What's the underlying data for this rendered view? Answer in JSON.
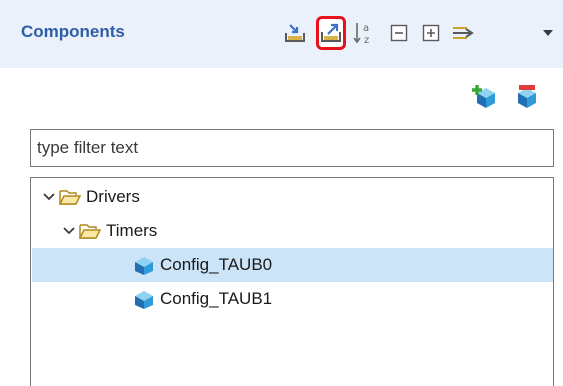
{
  "view": {
    "title": "Components"
  },
  "toolbar": {
    "buttons": [
      {
        "name": "import-icon"
      },
      {
        "name": "export-icon"
      },
      {
        "name": "sort-alphabetically-icon"
      },
      {
        "name": "collapse-all-icon"
      },
      {
        "name": "expand-all-icon"
      },
      {
        "name": "link-with-editor-icon"
      },
      {
        "name": "view-menu-chevron-icon"
      }
    ],
    "highlight_color": "#e8121c"
  },
  "actions": {
    "add": {
      "name": "add-component-icon"
    },
    "remove": {
      "name": "remove-component-icon"
    }
  },
  "filter": {
    "placeholder": "type filter text",
    "value": ""
  },
  "tree": {
    "items": [
      {
        "label": "Drivers",
        "level": 0,
        "expanded": true,
        "type": "folder",
        "selected": false
      },
      {
        "label": "Timers",
        "level": 1,
        "expanded": true,
        "type": "folder",
        "selected": false
      },
      {
        "label": "Config_TAUB0",
        "level": 2,
        "type": "component",
        "selected": true
      },
      {
        "label": "Config_TAUB1",
        "level": 2,
        "type": "component",
        "selected": false
      }
    ]
  },
  "colors": {
    "header_bg": "#eaf1fa",
    "title": "#2f5da8",
    "selection": "#cce4f7"
  }
}
